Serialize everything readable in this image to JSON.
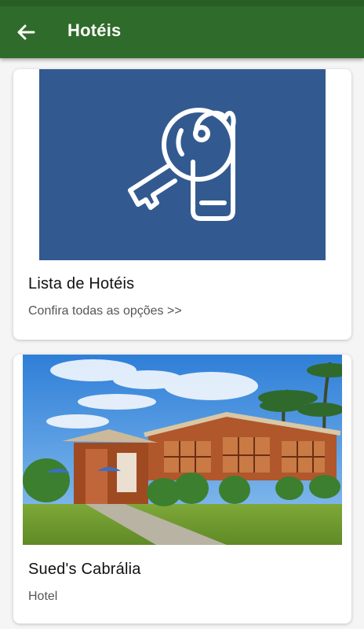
{
  "appbar": {
    "title": "Hotéis",
    "back_icon": "arrow-left-icon",
    "color": "#2f6b2a"
  },
  "cards": [
    {
      "title": "Lista de Hotéis",
      "subtitle": "Confira todas as opções >>",
      "image": "key-with-tag-icon",
      "image_bg": "#335a90"
    },
    {
      "title": "Sued's Cabrália",
      "subtitle": "Hotel",
      "image": "hotel-photo"
    }
  ]
}
